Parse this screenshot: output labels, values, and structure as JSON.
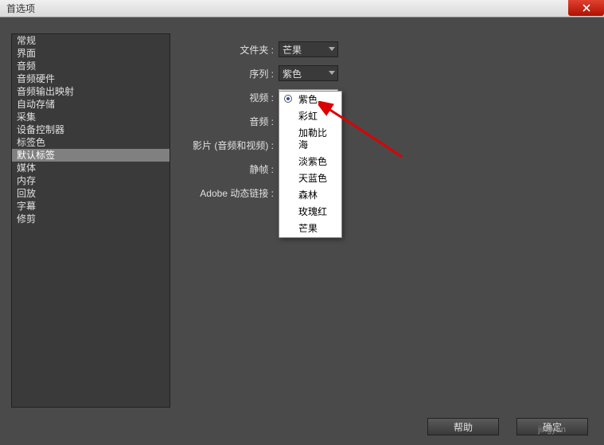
{
  "window": {
    "title": "首选项"
  },
  "sidebar": {
    "items": [
      "常规",
      "界面",
      "音频",
      "音频硬件",
      "音频输出映射",
      "自动存储",
      "采集",
      "设备控制器",
      "标签色",
      "默认标签",
      "媒体",
      "内存",
      "回放",
      "字幕",
      "修剪"
    ],
    "selected_index": 9
  },
  "form": {
    "rows": [
      {
        "label": "文件夹 :",
        "value": "芒果"
      },
      {
        "label": "序列 :",
        "value": "紫色"
      },
      {
        "label": "视频 :",
        "value": "紫色",
        "open": true
      },
      {
        "label": "音频 :",
        "value": ""
      },
      {
        "label": "影片 (音频和视频) :",
        "value": ""
      },
      {
        "label": "静帧 :",
        "value": ""
      },
      {
        "label": "Adobe 动态链接 :",
        "value": ""
      }
    ]
  },
  "dropdown_menu": {
    "options": [
      "紫色",
      "彩虹",
      "加勒比海",
      "淡紫色",
      "天蓝色",
      "森林",
      "玫瑰红",
      "芒果"
    ],
    "selected_index": 0
  },
  "buttons": {
    "help": "帮助",
    "ok": "确定"
  },
  "watermark": "jingyan"
}
